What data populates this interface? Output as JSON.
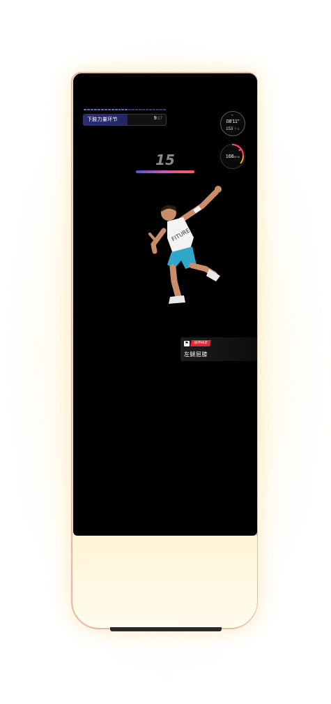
{
  "workout": {
    "section_title": "下肢力量环节",
    "current_step": "9",
    "total_steps": "/17",
    "progress_fraction": 0.53,
    "segments_total": 24,
    "segments_done": 13
  },
  "stats": {
    "timer": "08'11\"",
    "calories": "153",
    "calories_unit": "千卡",
    "heart_rate": "168",
    "heart_rate_unit": "BPM"
  },
  "reps": {
    "count": "15"
  },
  "athlete": {
    "shirt_text": "FITURE"
  },
  "correction": {
    "label": "动作纠正",
    "message": "左腿屈膝"
  },
  "colors": {
    "frame": "#e9b7a0",
    "screen": "#000000",
    "glow": "#fff2cc",
    "accent_red": "#e0283a",
    "progress_fill": "#2c2f74",
    "rep_bar_start": "#5c4fd6",
    "rep_bar_end": "#ff5a5a"
  },
  "icons": {
    "timer": "stopwatch-icon",
    "heart": "heart-icon",
    "correction": "posture-icon"
  }
}
